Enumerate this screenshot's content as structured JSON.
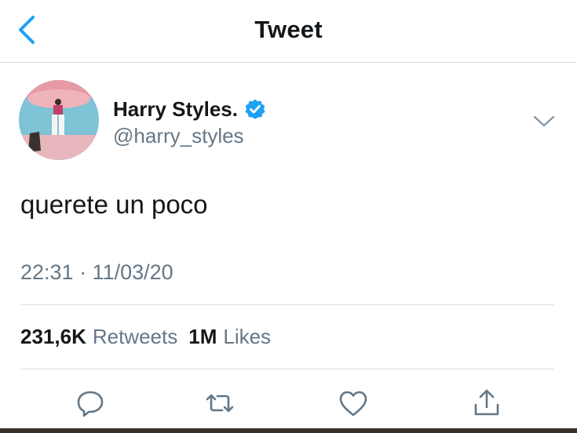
{
  "header": {
    "title": "Tweet",
    "back_icon": "chevron-left-icon"
  },
  "tweet": {
    "author": {
      "display_name": "Harry Styles.",
      "handle": "@harry_styles",
      "verified": true
    },
    "text": "querete un poco",
    "timestamp": "22:31 · 11/03/20",
    "stats": {
      "retweets_count": "231,6K",
      "retweets_label": "Retweets",
      "likes_count": "1M",
      "likes_label": "Likes"
    }
  },
  "actions": [
    "reply-icon",
    "retweet-icon",
    "like-icon",
    "share-icon"
  ],
  "colors": {
    "accent": "#1da1f2",
    "text_primary": "#14171a",
    "text_secondary": "#657786",
    "divider": "#dcdfe3",
    "icon_gray": "#657786"
  }
}
